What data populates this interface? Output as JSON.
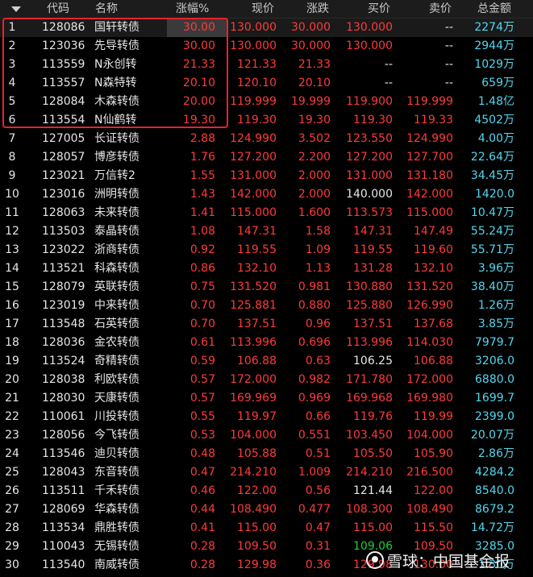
{
  "columns": {
    "code": "代码",
    "name": "名称",
    "pct": "涨幅%",
    "price": "现价",
    "change": "涨跌",
    "bid": "买价",
    "ask": "卖价",
    "amount": "总金额"
  },
  "rows": [
    {
      "idx": "1",
      "code": "128086",
      "name": "国轩转债",
      "pct": "30.00",
      "price": "130.000",
      "change": "30.000",
      "bid": "130.000",
      "ask": "--",
      "amount": "2274万"
    },
    {
      "idx": "2",
      "code": "123036",
      "name": "先导转债",
      "pct": "30.00",
      "price": "130.000",
      "change": "30.000",
      "bid": "130.000",
      "ask": "--",
      "amount": "2944万"
    },
    {
      "idx": "3",
      "code": "113559",
      "name": "N永创转",
      "pct": "21.33",
      "price": "121.33",
      "change": "21.33",
      "bid": "--",
      "ask": "--",
      "amount": "1029万"
    },
    {
      "idx": "4",
      "code": "113557",
      "name": "N森特转",
      "pct": "20.10",
      "price": "120.10",
      "change": "20.10",
      "bid": "--",
      "ask": "--",
      "amount": "659万"
    },
    {
      "idx": "5",
      "code": "128084",
      "name": "木森转债",
      "pct": "20.00",
      "price": "119.999",
      "change": "19.999",
      "bid": "119.900",
      "ask": "119.999",
      "amount": "1.48亿"
    },
    {
      "idx": "6",
      "code": "113554",
      "name": "N仙鹤转",
      "pct": "19.30",
      "price": "119.30",
      "change": "19.30",
      "bid": "119.30",
      "ask": "119.33",
      "amount": "4502万"
    },
    {
      "idx": "7",
      "code": "127005",
      "name": "长证转债",
      "pct": "2.88",
      "price": "124.990",
      "change": "3.502",
      "bid": "123.550",
      "ask": "124.990",
      "amount": "4.00万"
    },
    {
      "idx": "8",
      "code": "128057",
      "name": "博彦转债",
      "pct": "1.76",
      "price": "127.200",
      "change": "2.200",
      "bid": "127.200",
      "ask": "127.700",
      "amount": "22.64万"
    },
    {
      "idx": "9",
      "code": "123021",
      "name": "万信转2",
      "pct": "1.55",
      "price": "131.000",
      "change": "2.000",
      "bid": "131.000",
      "ask": "131.180",
      "amount": "34.45万"
    },
    {
      "idx": "10",
      "code": "123016",
      "name": "洲明转债",
      "pct": "1.43",
      "price": "142.000",
      "change": "2.000",
      "bid": "140.000",
      "ask": "142.000",
      "amount": "1420.0"
    },
    {
      "idx": "11",
      "code": "128063",
      "name": "未来转债",
      "pct": "1.41",
      "price": "115.000",
      "change": "1.600",
      "bid": "113.573",
      "ask": "115.000",
      "amount": "10.47万"
    },
    {
      "idx": "12",
      "code": "113503",
      "name": "泰晶转债",
      "pct": "1.08",
      "price": "147.31",
      "change": "1.58",
      "bid": "147.31",
      "ask": "147.49",
      "amount": "55.24万"
    },
    {
      "idx": "13",
      "code": "123022",
      "name": "浙商转债",
      "pct": "0.92",
      "price": "119.55",
      "change": "1.09",
      "bid": "119.55",
      "ask": "119.60",
      "amount": "55.71万"
    },
    {
      "idx": "14",
      "code": "113521",
      "name": "科森转债",
      "pct": "0.86",
      "price": "132.10",
      "change": "1.13",
      "bid": "131.28",
      "ask": "132.10",
      "amount": "3.96万"
    },
    {
      "idx": "15",
      "code": "128079",
      "name": "英联转债",
      "pct": "0.75",
      "price": "131.520",
      "change": "0.981",
      "bid": "130.880",
      "ask": "131.520",
      "amount": "38.40万"
    },
    {
      "idx": "16",
      "code": "123019",
      "name": "中来转债",
      "pct": "0.70",
      "price": "125.881",
      "change": "0.880",
      "bid": "125.880",
      "ask": "126.990",
      "amount": "1.26万"
    },
    {
      "idx": "17",
      "code": "113548",
      "name": "石英转债",
      "pct": "0.70",
      "price": "137.51",
      "change": "0.96",
      "bid": "137.51",
      "ask": "137.68",
      "amount": "3.85万"
    },
    {
      "idx": "18",
      "code": "128036",
      "name": "金农转债",
      "pct": "0.61",
      "price": "113.996",
      "change": "0.696",
      "bid": "113.996",
      "ask": "114.030",
      "amount": "7979.7"
    },
    {
      "idx": "19",
      "code": "113524",
      "name": "奇精转债",
      "pct": "0.59",
      "price": "106.88",
      "change": "0.63",
      "bid": "106.25",
      "ask": "106.88",
      "amount": "3206.0"
    },
    {
      "idx": "20",
      "code": "128038",
      "name": "利欧转债",
      "pct": "0.57",
      "price": "172.000",
      "change": "0.982",
      "bid": "171.780",
      "ask": "172.000",
      "amount": "6880.0"
    },
    {
      "idx": "21",
      "code": "128030",
      "name": "天康转债",
      "pct": "0.57",
      "price": "169.969",
      "change": "0.969",
      "bid": "169.968",
      "ask": "169.980",
      "amount": "1699.7"
    },
    {
      "idx": "22",
      "code": "110061",
      "name": "川投转债",
      "pct": "0.55",
      "price": "119.97",
      "change": "0.66",
      "bid": "119.76",
      "ask": "119.99",
      "amount": "2399.0"
    },
    {
      "idx": "23",
      "code": "128056",
      "name": "今飞转债",
      "pct": "0.53",
      "price": "104.000",
      "change": "0.551",
      "bid": "103.450",
      "ask": "104.000",
      "amount": "20.07万"
    },
    {
      "idx": "24",
      "code": "113546",
      "name": "迪贝转债",
      "pct": "0.48",
      "price": "105.88",
      "change": "0.51",
      "bid": "105.50",
      "ask": "105.90",
      "amount": "2.86万"
    },
    {
      "idx": "25",
      "code": "128043",
      "name": "东音转债",
      "pct": "0.47",
      "price": "214.210",
      "change": "1.009",
      "bid": "214.210",
      "ask": "216.500",
      "amount": "4284.2"
    },
    {
      "idx": "26",
      "code": "113511",
      "name": "千禾转债",
      "pct": "0.46",
      "price": "122.00",
      "change": "0.56",
      "bid": "121.44",
      "ask": "122.00",
      "amount": "8540.0"
    },
    {
      "idx": "27",
      "code": "128069",
      "name": "华森转债",
      "pct": "0.44",
      "price": "108.490",
      "change": "0.477",
      "bid": "108.300",
      "ask": "108.490",
      "amount": "8679.2"
    },
    {
      "idx": "28",
      "code": "113534",
      "name": "鼎胜转债",
      "pct": "0.41",
      "price": "115.00",
      "change": "0.47",
      "bid": "115.00",
      "ask": "115.50",
      "amount": "14.72万"
    },
    {
      "idx": "29",
      "code": "110043",
      "name": "无锡转债",
      "pct": "0.28",
      "price": "109.50",
      "change": "0.31",
      "bid": "109.06",
      "ask": "109.50",
      "amount": "3285.0"
    },
    {
      "idx": "30",
      "code": "113540",
      "name": "南威转债",
      "pct": "0.28",
      "price": "129.98",
      "change": "0.36",
      "bid": "129.98",
      "ask": "130.00",
      "amount": "1.30万"
    }
  ],
  "watermark": "雪球：中国基金报",
  "colors": {
    "up": "#ff3a3a",
    "neutral": "#e6e6e6",
    "down": "#1ccf3a",
    "amount": "#52d7ee",
    "highlight": "#e8232e"
  }
}
